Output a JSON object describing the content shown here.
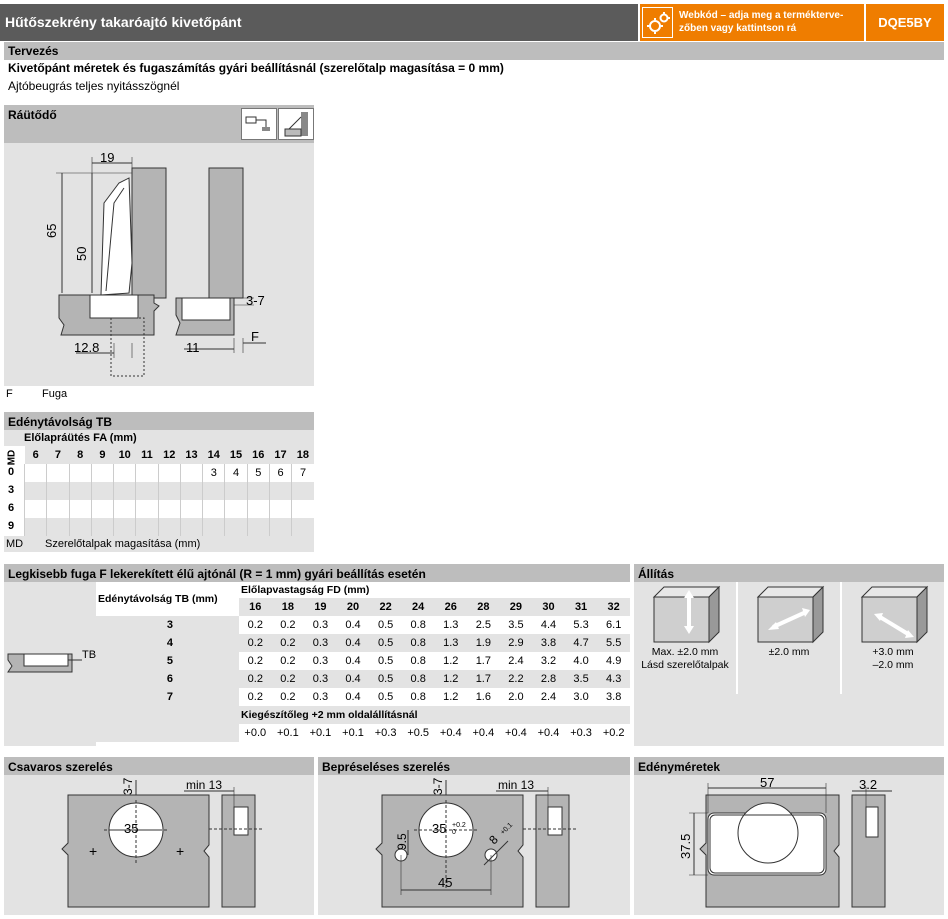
{
  "header": {
    "title": "Hűtőszekrény takaróajtó kivetőpánt",
    "webcode_text_1": "Webkód – adja meg a termékterve-",
    "webcode_text_2": "zőben vagy kattintson rá",
    "code": "DQE5BY",
    "accent": "#ef7d00",
    "title_bg": "#5b5b5b"
  },
  "design": {
    "heading": "Tervezés",
    "subheading": "Kivetőpánt méretek és fugaszámítás gyári beállításnál (szerelőtalp magasítása = 0 mm)",
    "line": "Ajtóbeugrás teljes nyitásszögnél"
  },
  "rautodo": {
    "heading": "Ráütődő",
    "dims": {
      "d19": "19",
      "d65": "65",
      "d50": "50",
      "d128": "12.8",
      "d37": "3-7",
      "d11": "11",
      "dF": "F"
    },
    "legend_key": "F",
    "legend_val": "Fuga"
  },
  "tb": {
    "heading": "Edénytávolság TB",
    "fa_label": "Előlapráütés FA (mm)",
    "md_label": "MD",
    "fa_values": [
      "6",
      "7",
      "8",
      "9",
      "10",
      "11",
      "12",
      "13",
      "14",
      "15",
      "16",
      "17",
      "18"
    ],
    "rows": [
      {
        "md": "0",
        "cells": [
          "",
          "",
          "",
          "",
          "",
          "",
          "",
          "",
          "3",
          "4",
          "5",
          "6",
          "7"
        ]
      },
      {
        "md": "3",
        "cells": [
          "",
          "",
          "",
          "",
          "",
          "",
          "",
          "",
          "",
          "",
          "",
          "",
          ""
        ]
      },
      {
        "md": "6",
        "cells": [
          "",
          "",
          "",
          "",
          "",
          "",
          "",
          "",
          "",
          "",
          "",
          "",
          ""
        ]
      },
      {
        "md": "9",
        "cells": [
          "",
          "",
          "",
          "",
          "",
          "",
          "",
          "",
          "",
          "",
          "",
          "",
          ""
        ]
      }
    ],
    "legend_key": "MD",
    "legend_val": "Szerelőtalpak magasítása (mm)"
  },
  "fuga": {
    "heading": "Legkisebb fuga F lekerekített élű ajtónál (R = 1 mm) gyári beállítás esetén",
    "tb_label": "TB",
    "tb_col_label": "Edénytávolság TB (mm)",
    "fd_label": "Előlapvastagság FD (mm)",
    "fd_values": [
      "16",
      "18",
      "19",
      "20",
      "22",
      "24",
      "26",
      "28",
      "29",
      "30",
      "31",
      "32"
    ],
    "rows": [
      {
        "tb": "3",
        "cells": [
          "0.2",
          "0.2",
          "0.3",
          "0.4",
          "0.5",
          "0.8",
          "1.3",
          "2.5",
          "3.5",
          "4.4",
          "5.3",
          "6.1"
        ]
      },
      {
        "tb": "4",
        "cells": [
          "0.2",
          "0.2",
          "0.3",
          "0.4",
          "0.5",
          "0.8",
          "1.3",
          "1.9",
          "2.9",
          "3.8",
          "4.7",
          "5.5"
        ]
      },
      {
        "tb": "5",
        "cells": [
          "0.2",
          "0.2",
          "0.3",
          "0.4",
          "0.5",
          "0.8",
          "1.2",
          "1.7",
          "2.4",
          "3.2",
          "4.0",
          "4.9"
        ]
      },
      {
        "tb": "6",
        "cells": [
          "0.2",
          "0.2",
          "0.3",
          "0.4",
          "0.5",
          "0.8",
          "1.2",
          "1.7",
          "2.2",
          "2.8",
          "3.5",
          "4.3"
        ]
      },
      {
        "tb": "7",
        "cells": [
          "0.2",
          "0.2",
          "0.3",
          "0.4",
          "0.5",
          "0.8",
          "1.2",
          "1.6",
          "2.0",
          "2.4",
          "3.0",
          "3.8"
        ]
      }
    ],
    "side_label": "Kiegészítőleg +2 mm oldalállításnál",
    "side_values": [
      "+0.0",
      "+0.1",
      "+0.1",
      "+0.1",
      "+0.3",
      "+0.5",
      "+0.4",
      "+0.4",
      "+0.4",
      "+0.4",
      "+0.3",
      "+0.2"
    ]
  },
  "allitas": {
    "heading": "Állítás",
    "items": [
      {
        "line1": "Max. ±2.0 mm",
        "line2": "Lásd szerelőtalpak"
      },
      {
        "line1": "±2.0 mm",
        "line2": ""
      },
      {
        "line1": "+3.0 mm",
        "line2": "–2.0 mm"
      }
    ]
  },
  "csavaros": {
    "heading": "Csavaros szerelés",
    "d37": "3-7",
    "dmin13": "min 13",
    "d35": "35"
  },
  "bepreseles": {
    "heading": "Bepréseléses szerelés",
    "d37": "3-7",
    "dmin13": "min 13",
    "d35": "35",
    "tol_up": "+0.2",
    "tol_dn": "0",
    "d95": "9.5",
    "d8": "8",
    "tol8": "+0.1",
    "d45": "45"
  },
  "edeny": {
    "heading": "Edényméretek",
    "d57": "57",
    "d32": "3.2",
    "d375": "37.5"
  }
}
